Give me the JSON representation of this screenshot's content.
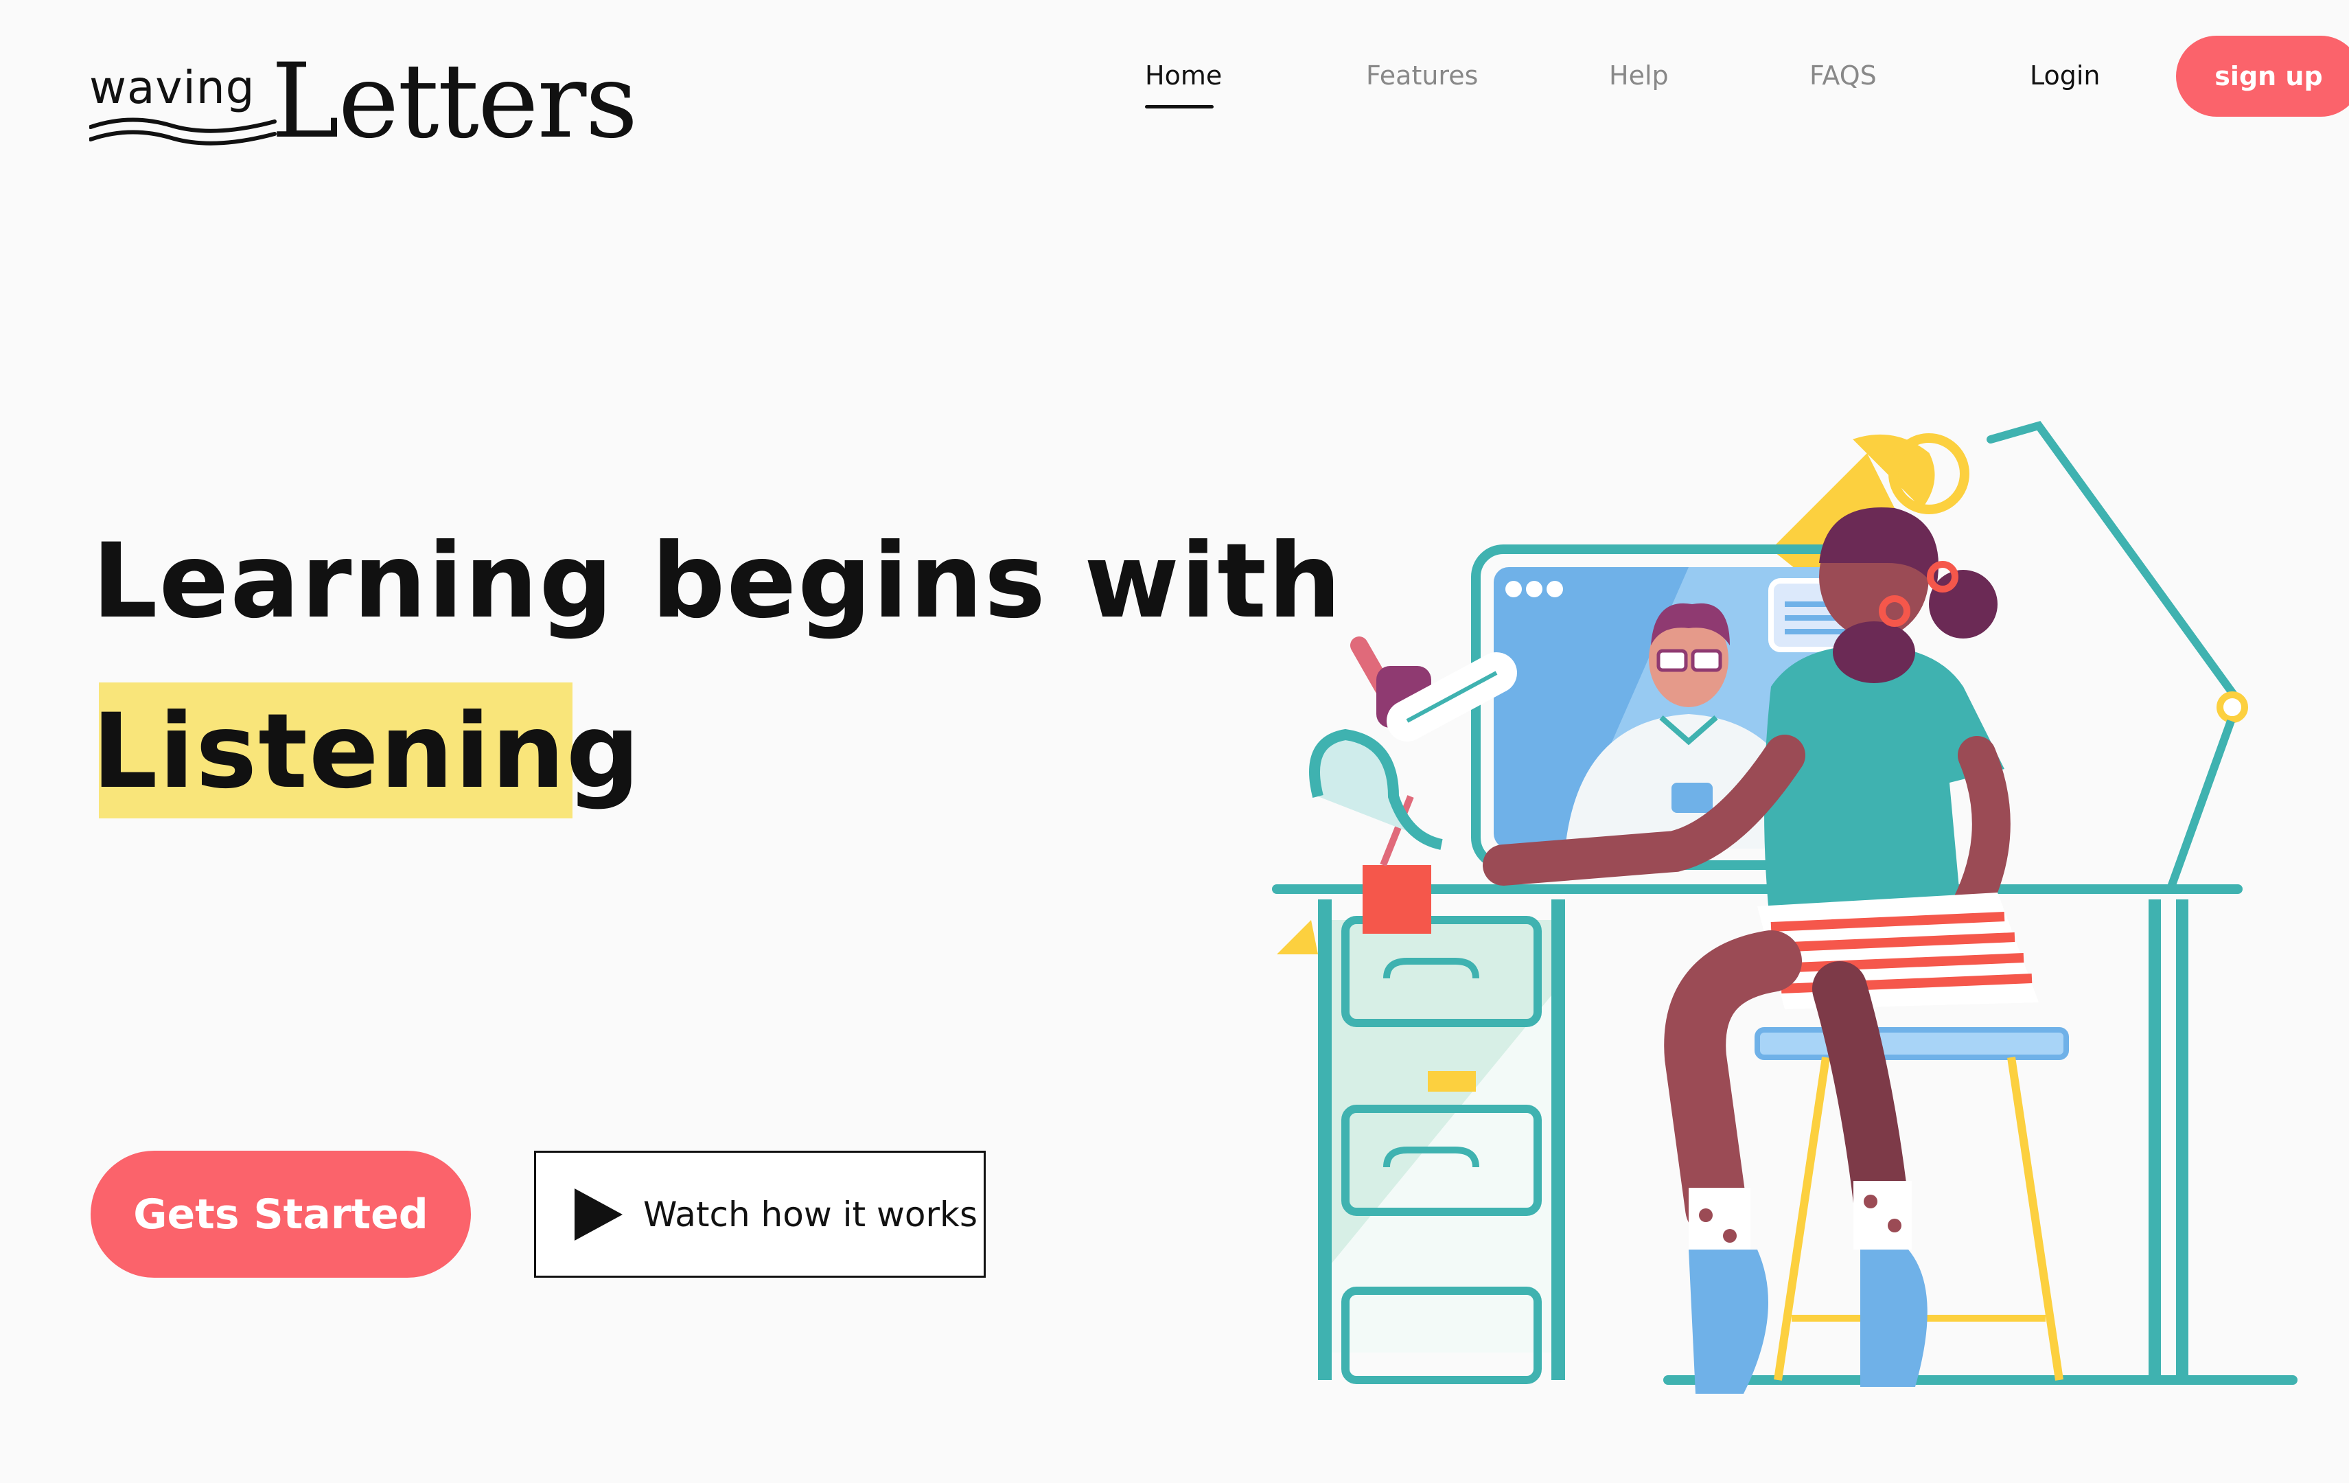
{
  "logo": {
    "prefix": "waving",
    "name": "Letters"
  },
  "nav": {
    "items": [
      {
        "label": "Home",
        "active": true
      },
      {
        "label": "Features",
        "active": false
      },
      {
        "label": "Help",
        "active": false
      },
      {
        "label": "FAQS",
        "active": false
      }
    ],
    "login_label": "Login",
    "signup_label": "sign up"
  },
  "hero": {
    "headline_line1": "Learning begins with",
    "headline_line2": "Listening",
    "primary_cta": "Gets Started",
    "secondary_cta": "Watch how it works",
    "play_icon": "play-icon"
  },
  "colors": {
    "accent": "#fb636b",
    "highlight": "#f9e57a",
    "teal": "#3fb2b0",
    "text": "#111111",
    "muted": "#888888"
  }
}
